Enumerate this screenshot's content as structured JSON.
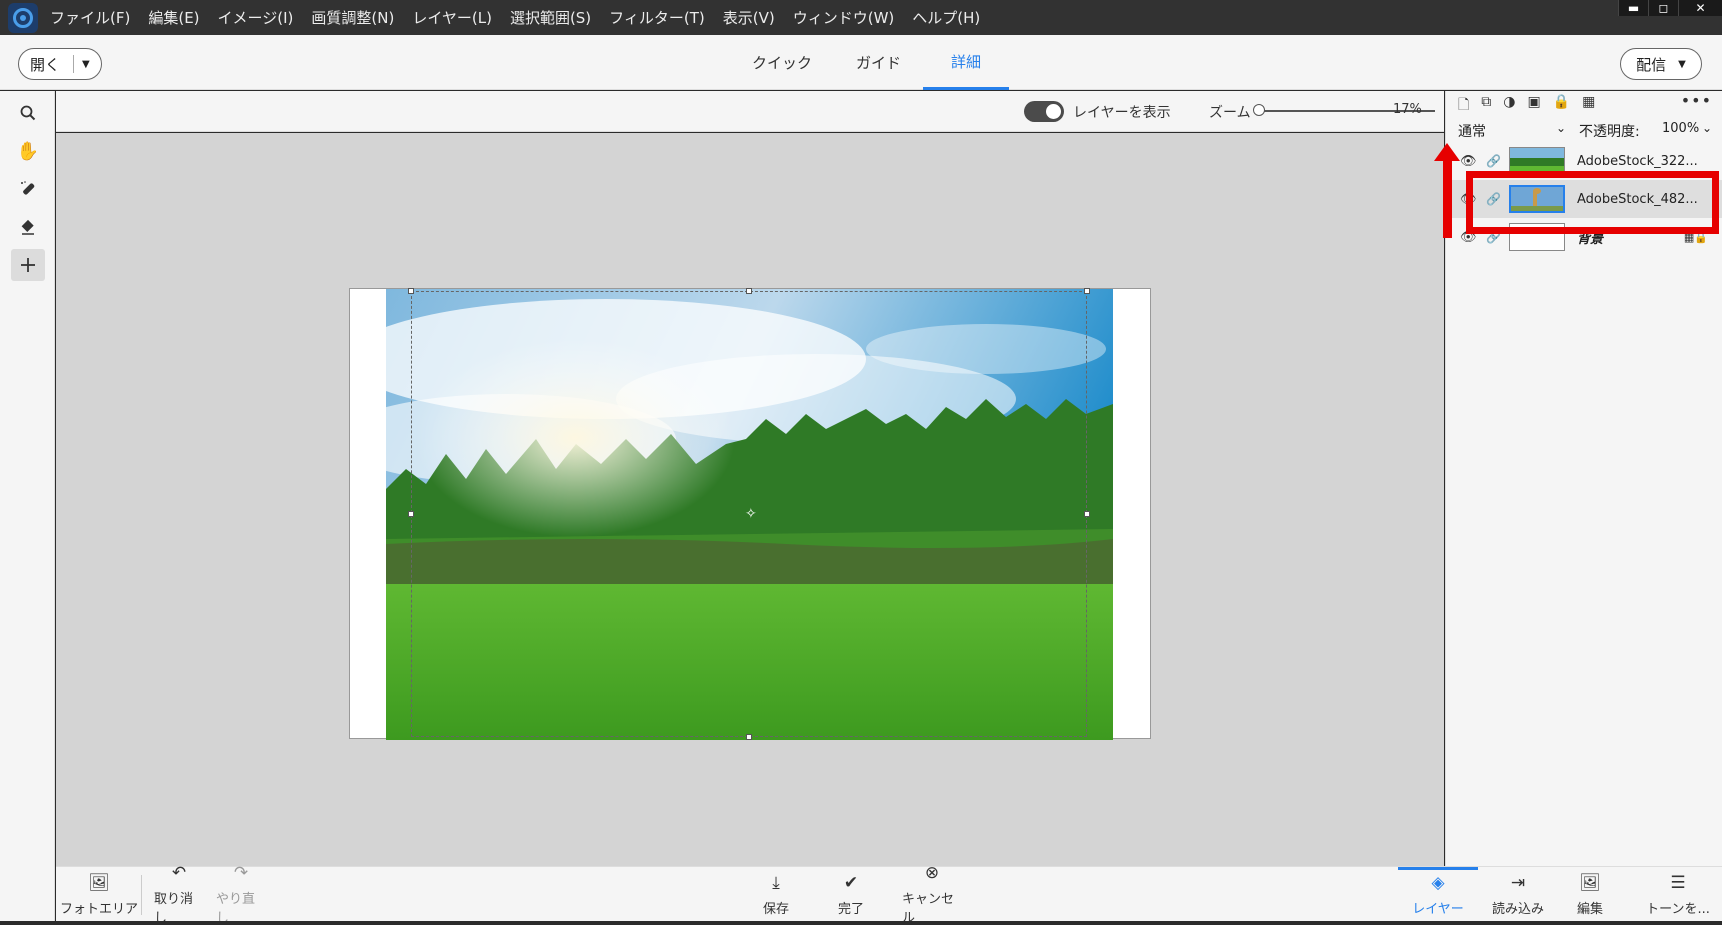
{
  "menu": [
    "ファイル(F)",
    "編集(E)",
    "イメージ(I)",
    "画質調整(N)",
    "レイヤー(L)",
    "選択範囲(S)",
    "フィルター(T)",
    "表示(V)",
    "ウィンドウ(W)",
    "ヘルプ(H)"
  ],
  "window_controls": {
    "minimize": "▬",
    "maximize": "◻",
    "close": "✕"
  },
  "topbar": {
    "open_label": "開く",
    "tabs": [
      "クイック",
      "ガイド",
      "詳細"
    ],
    "active_tab": "詳細",
    "share_label": "配信"
  },
  "options": {
    "show_layers_label": "レイヤーを表示",
    "zoom_label": "ズーム",
    "zoom_value": "17%"
  },
  "layers_panel": {
    "blend_mode": "通常",
    "opacity_label": "不透明度:",
    "opacity_value": "100%",
    "layers": [
      {
        "name": "AdobeStock_322...",
        "selected": false
      },
      {
        "name": "AdobeStock_482...",
        "selected": true
      },
      {
        "name": "背景",
        "selected": false
      }
    ]
  },
  "bottom": {
    "photo_bin": "フォトエリア",
    "undo": "取り消し",
    "redo": "やり直し",
    "save": "保存",
    "done": "完了",
    "cancel": "キャンセル",
    "layers": "レイヤー",
    "import": "読み込み",
    "edit": "編集",
    "tone": "トーンを..."
  },
  "colors": {
    "accent": "#2680eb",
    "annotation": "#e60000"
  }
}
